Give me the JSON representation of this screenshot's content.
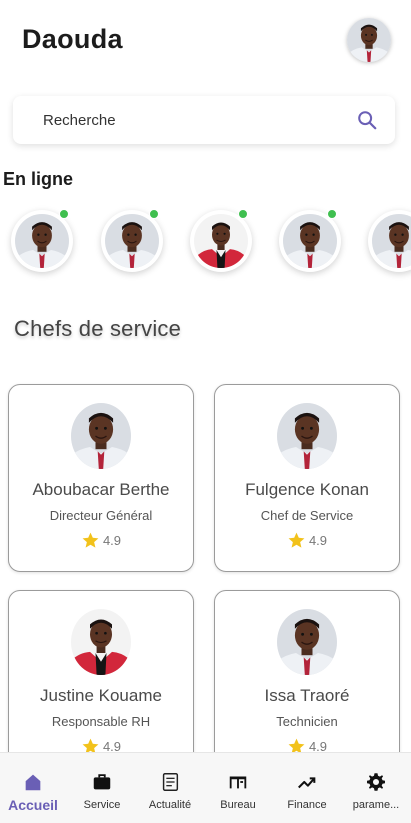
{
  "header": {
    "title": "Daouda"
  },
  "search": {
    "placeholder": "Recherche"
  },
  "online": {
    "title": "En ligne",
    "users": [
      {
        "photo": "man-white-shirt"
      },
      {
        "photo": "man-white-shirt"
      },
      {
        "photo": "man-red-jacket"
      },
      {
        "photo": "man-white-shirt"
      },
      {
        "photo": "man-white-shirt"
      }
    ]
  },
  "section": {
    "title": "Chefs de service"
  },
  "cards": [
    {
      "name": "Aboubacar Berthe",
      "role": "Directeur Général",
      "rating": "4.9",
      "photo": "man-white-shirt"
    },
    {
      "name": "Fulgence Konan",
      "role": "Chef de Service",
      "rating": "4.9",
      "photo": "man-white-shirt"
    },
    {
      "name": "Justine Kouame",
      "role": "Responsable RH",
      "rating": "4.9",
      "photo": "man-red-jacket"
    },
    {
      "name": "Issa Traoré",
      "role": "Technicien",
      "rating": "4.9",
      "photo": "man-white-shirt"
    }
  ],
  "nav": {
    "items": [
      {
        "label": "Accueil",
        "icon": "home-icon",
        "active": true
      },
      {
        "label": "Service",
        "icon": "briefcase-icon"
      },
      {
        "label": "Actualité",
        "icon": "news-icon"
      },
      {
        "label": "Bureau",
        "icon": "desk-icon"
      },
      {
        "label": "Finance",
        "icon": "trending-up-icon"
      },
      {
        "label": "parame...",
        "icon": "gear-icon"
      }
    ]
  },
  "colors": {
    "accent": "#6a5fb5",
    "online": "#3fbf4f",
    "star": "#f2c21b"
  }
}
